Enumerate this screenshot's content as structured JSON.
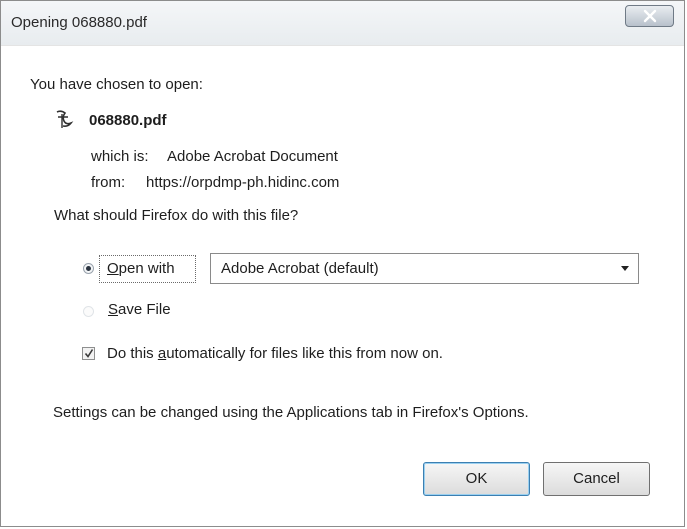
{
  "window": {
    "title": "Opening 068880.pdf"
  },
  "header": {
    "prompt": "You have chosen to open:"
  },
  "file": {
    "icon": "pdf-file-icon",
    "name": "068880.pdf",
    "type_label": "which is:",
    "type_value": "Adobe Acrobat Document",
    "from_label": "from:",
    "from_value": "https://orpdmp-ph.hidinc.com"
  },
  "question": "What should Firefox do with this file?",
  "options": {
    "open_with": {
      "accel": "O",
      "rest": "pen with",
      "selected": true
    },
    "save_file": {
      "accel": "S",
      "rest": "ave File",
      "selected": false
    }
  },
  "application_select": {
    "selected": "Adobe Acrobat  (default)"
  },
  "auto_checkbox": {
    "before": "Do this ",
    "accel": "a",
    "after": "utomatically for files like this from now on.",
    "checked": true
  },
  "settings_note": "Settings can be changed using the Applications tab in Firefox's Options.",
  "buttons": {
    "ok": "OK",
    "cancel": "Cancel"
  }
}
